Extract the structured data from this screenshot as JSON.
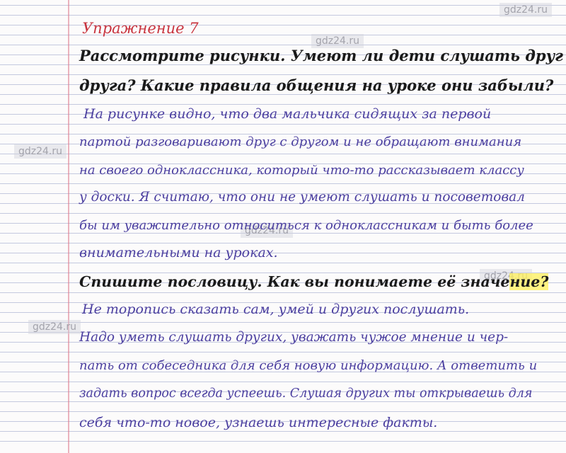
{
  "header": {
    "title": "Упражнение 7",
    "watermark": "gdz24.ru"
  },
  "task1": {
    "line1": "Рассмотрите рисунки. Умеют ли дети слушать друг",
    "line2": "друга? Какие правила общения на уроке они забыли?"
  },
  "answer1": {
    "lines": [
      "На рисунке видно, что два мальчика сидящих за первой",
      "партой разговаривают друг с другом и не обращают внимания",
      "на своего одноклассника, который что-то рассказывает классу",
      "у доски. Я считаю, что они не умеют слушать и посоветовал",
      "бы им уважительно относиться к одноклассникам и быть более",
      "внимательными на уроках."
    ]
  },
  "task2": {
    "text_before": "Спишите пословицу. Как вы понимаете её значе",
    "text_highlight": "ние?"
  },
  "answer2": {
    "lines": [
      "Не торопись сказать сам, умей и других послушать.",
      "Надо уметь слушать других, уважать чужое мнение и чер-",
      "пать от собеседника для себя новую информацию. А ответить и",
      "задать вопрос всегда успеешь. Слушая других ты открываешь для",
      "себя что-то новое, узнаешь интересные факты."
    ]
  },
  "colors": {
    "title": "#c8343f",
    "task": "#1a1a1a",
    "handwriting": "#4b3fa0",
    "highlight": "#fff05a"
  }
}
